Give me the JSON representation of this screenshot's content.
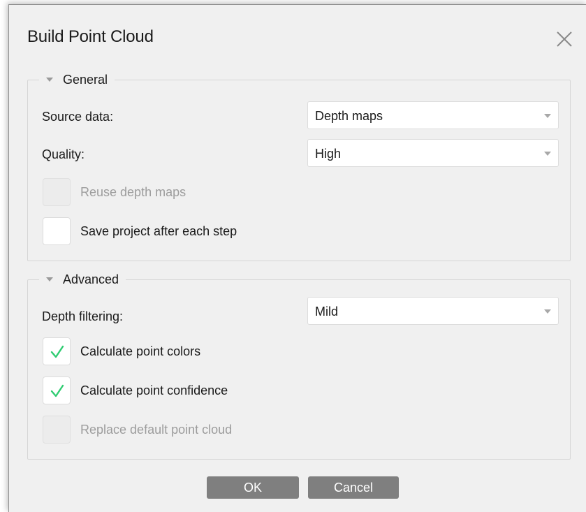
{
  "dialog": {
    "title": "Build Point Cloud"
  },
  "general": {
    "header": "General",
    "source_data": {
      "label": "Source data:",
      "value": "Depth maps"
    },
    "quality": {
      "label": "Quality:",
      "value": "High"
    },
    "reuse_depth_maps": {
      "label": "Reuse depth maps",
      "checked": false,
      "enabled": false
    },
    "save_project": {
      "label": "Save project after each step",
      "checked": false,
      "enabled": true
    }
  },
  "advanced": {
    "header": "Advanced",
    "depth_filtering": {
      "label": "Depth filtering:",
      "value": "Mild"
    },
    "calc_point_colors": {
      "label": "Calculate point colors",
      "checked": true,
      "enabled": true
    },
    "calc_point_confidence": {
      "label": "Calculate point confidence",
      "checked": true,
      "enabled": true
    },
    "replace_default": {
      "label": "Replace default point cloud",
      "checked": false,
      "enabled": false
    }
  },
  "buttons": {
    "ok": "OK",
    "cancel": "Cancel"
  },
  "colors": {
    "check_accent": "#2ecc71",
    "button_bg": "#7f7f7f",
    "dialog_bg": "#f0f0f0"
  },
  "icons": {
    "close": "close-icon",
    "collapse": "collapse-triangle-icon",
    "dropdown": "chevron-down-icon",
    "check": "checkmark-icon"
  }
}
